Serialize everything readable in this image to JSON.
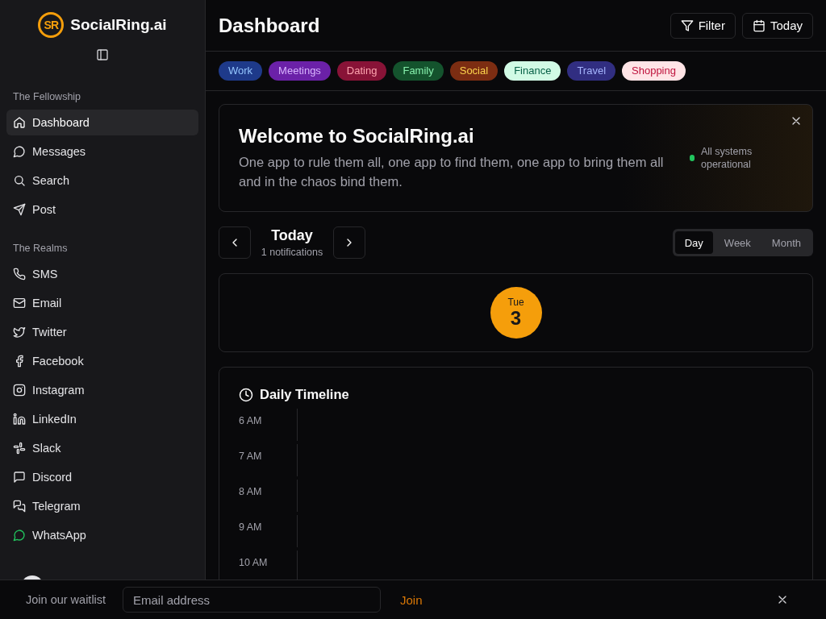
{
  "sidebar": {
    "brand": "SocialRing.ai",
    "logo_text": "SR",
    "sections": [
      {
        "title": "The Fellowship",
        "items": [
          {
            "label": "Dashboard",
            "selected": true
          },
          {
            "label": "Messages",
            "selected": false
          },
          {
            "label": "Search",
            "selected": false
          },
          {
            "label": "Post",
            "selected": false
          }
        ]
      },
      {
        "title": "The Realms",
        "items": [
          {
            "label": "SMS",
            "selected": false
          },
          {
            "label": "Email",
            "selected": false
          },
          {
            "label": "Twitter",
            "selected": false
          },
          {
            "label": "Facebook",
            "selected": false
          },
          {
            "label": "Instagram",
            "selected": false
          },
          {
            "label": "LinkedIn",
            "selected": false
          },
          {
            "label": "Slack",
            "selected": false
          },
          {
            "label": "Discord",
            "selected": false
          },
          {
            "label": "Telegram",
            "selected": false
          },
          {
            "label": "WhatsApp",
            "selected": false
          }
        ]
      }
    ]
  },
  "header": {
    "title": "Dashboard",
    "buttons": [
      "Filter",
      "Today"
    ]
  },
  "tags": [
    {
      "label": "Work",
      "color": "#1e3a8a"
    },
    {
      "label": "Meetings",
      "color": "#6b21a8"
    },
    {
      "label": "Dating",
      "color": "#881337"
    },
    {
      "label": "Family",
      "color": "#14532d"
    },
    {
      "label": "Social",
      "color": "#7c2d12"
    },
    {
      "label": "Finance",
      "color": "#d1fae5"
    },
    {
      "label": "Travel",
      "color": "#312e81"
    },
    {
      "label": "Shopping",
      "color": "#ffe4e6"
    }
  ],
  "welcome": {
    "title": "Welcome to SocialRing.ai",
    "text": "One app to rule them all, one app to find them, one app to bring them all and in the chaos bind them.",
    "status": "All systems operational"
  },
  "calendar": {
    "title": "Today",
    "subtitle": "1 notifications",
    "views": [
      {
        "label": "Day",
        "selected": true
      },
      {
        "label": "Week",
        "selected": false
      },
      {
        "label": "Month",
        "selected": false
      }
    ],
    "day": {
      "weekday": "Tue",
      "date": "3"
    }
  },
  "timeline": {
    "title": "Daily Timeline",
    "hours": [
      "6 AM",
      "7 AM",
      "8 AM",
      "9 AM",
      "10 AM"
    ]
  },
  "waitlist": {
    "label": "Join our waitlist",
    "placeholder": "Email address",
    "button": "Join"
  }
}
